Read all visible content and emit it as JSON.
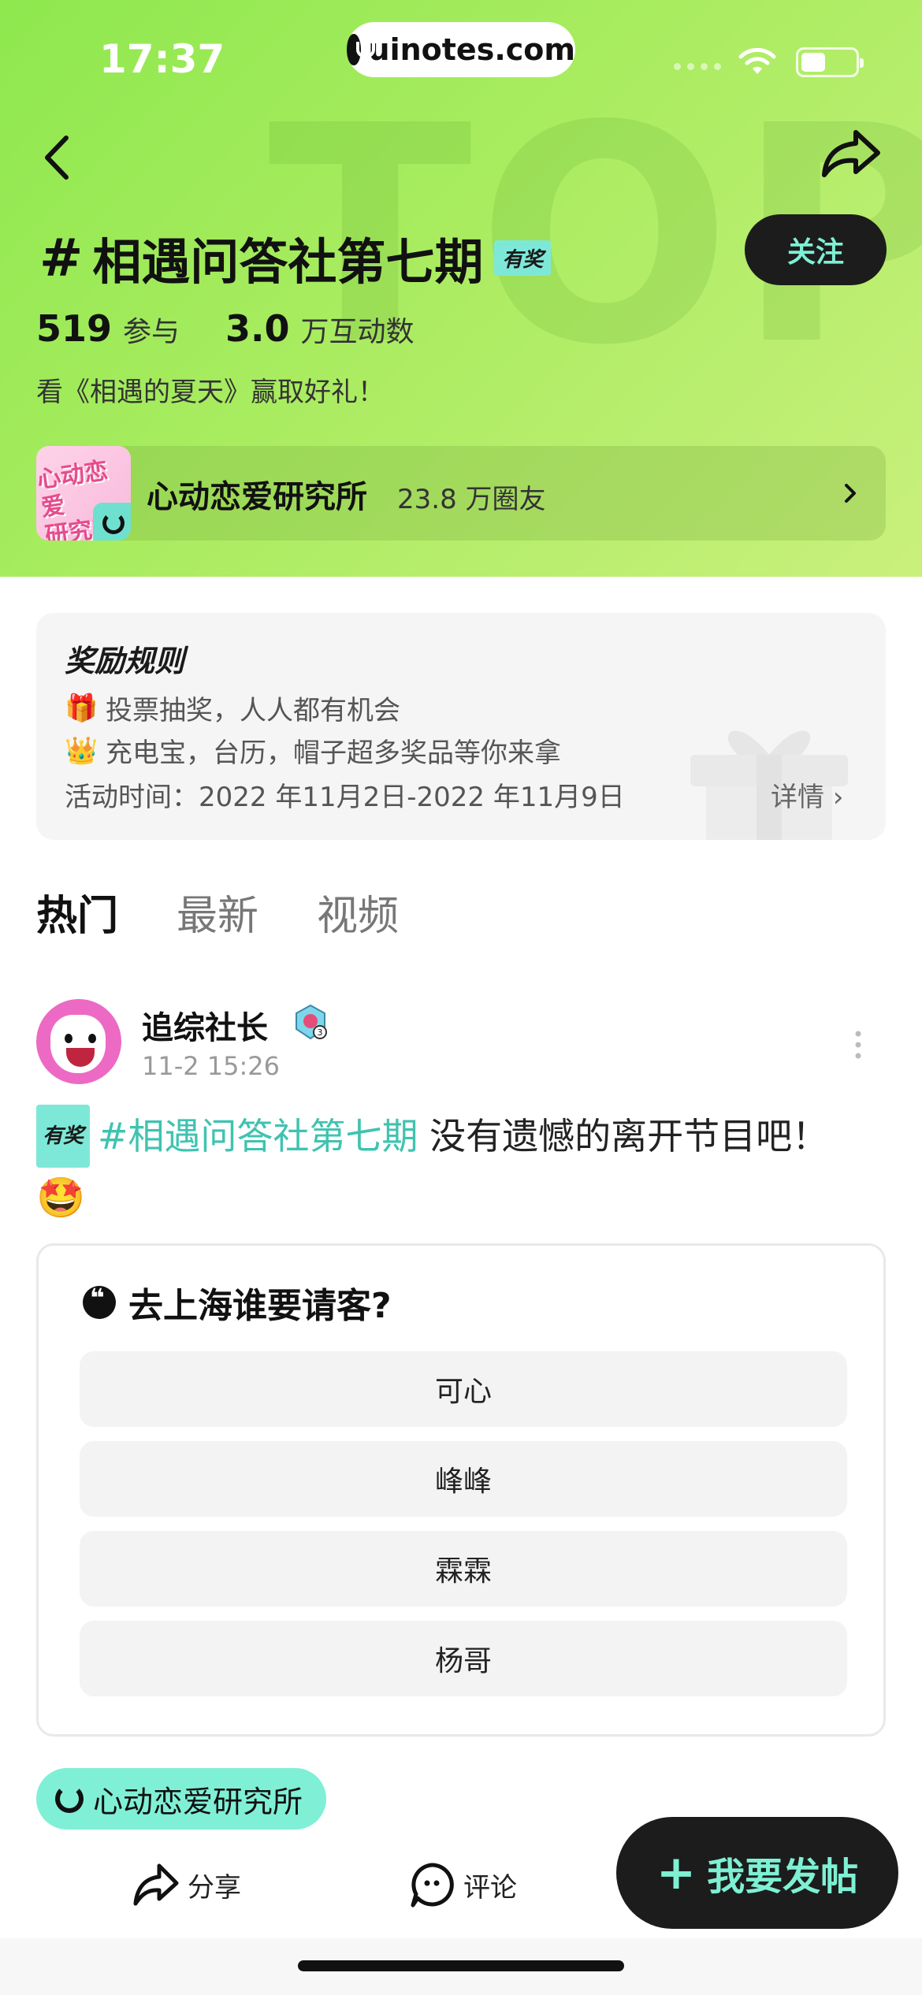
{
  "status_bar": {
    "time": "17:37",
    "url": "uinotes.com"
  },
  "hero": {
    "watermark": "TOPIC",
    "hash": "#",
    "title": "相遇问答社第七期",
    "badge": "有奖",
    "follow_label": "关注",
    "participants_count": "519",
    "participants_label": "参与",
    "interactions_count": "3.0",
    "interactions_label": "万互动数",
    "description": "看《相遇的夏天》赢取好礼！",
    "circle": {
      "thumb_text": "心动恋爱研究所",
      "name": "心动恋爱研究所",
      "members": "23.8 万圈友"
    }
  },
  "rules": {
    "title": "奖励规则",
    "line1_emoji": "🎁",
    "line1": "投票抽奖，人人都有机会",
    "line2_emoji": "👑",
    "line2": "充电宝，台历，帽子超多奖品等你来拿",
    "time": "活动时间：2022 年11月2日-2022 年11月9日",
    "detail_label": "详情"
  },
  "tabs": [
    {
      "label": "热门",
      "active": true
    },
    {
      "label": "最新",
      "active": false
    },
    {
      "label": "视频",
      "active": false
    }
  ],
  "post": {
    "author": "追综社长",
    "time": "11-2 15:26",
    "badge": "有奖",
    "topic": "#相遇问答社第七期",
    "text": " 没有遗憾的离开节目吧！",
    "emoji": "🤩",
    "poll": {
      "question": "去上海谁要请客?",
      "options": [
        "可心",
        "峰峰",
        "霖霖",
        "杨哥"
      ]
    },
    "circle_tag": "心动恋爱研究所"
  },
  "bottom_bar": {
    "share_label": "分享",
    "comment_label": "评论",
    "post_label": "我要发帖"
  },
  "colors": {
    "hero_green": "#a9ec60",
    "accent_mint": "#7ef0d4",
    "dark": "#1c1c1c"
  }
}
